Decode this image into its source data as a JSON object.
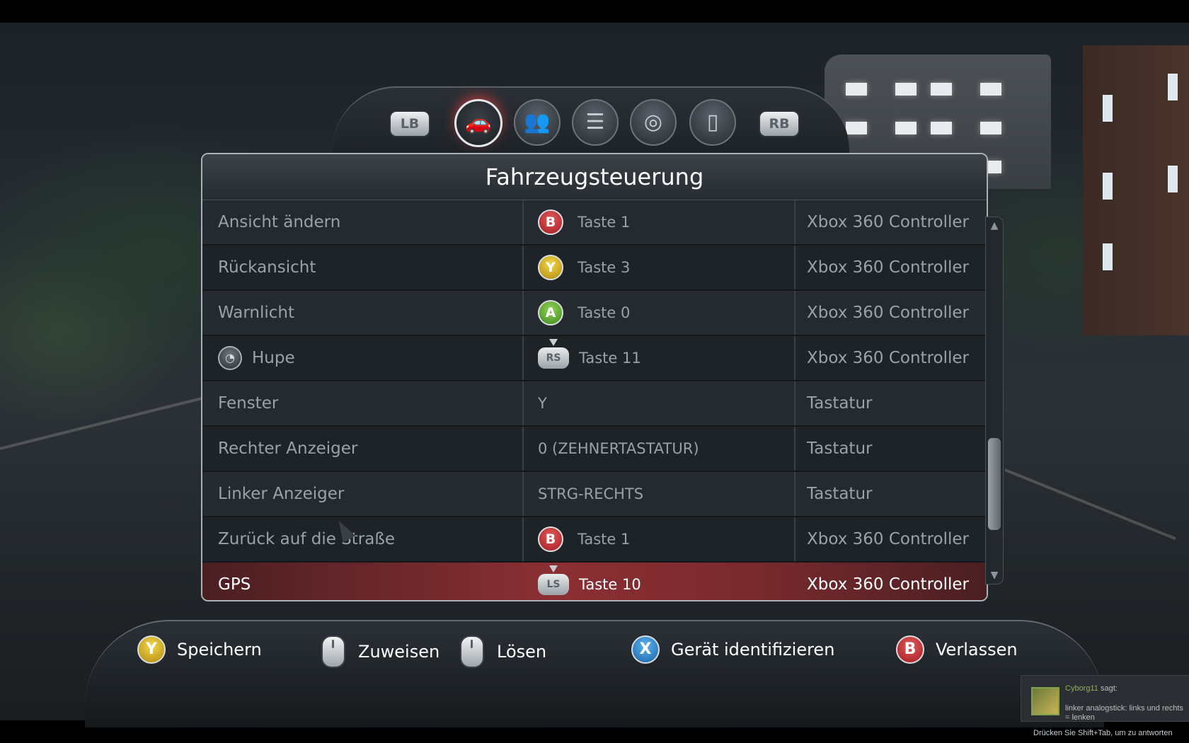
{
  "tabs": {
    "left_bumper": "LB",
    "right_bumper": "RB",
    "icons": [
      "car-icon",
      "people-icon",
      "settings-list-icon",
      "steering-joystick-icon",
      "mouse-icon"
    ],
    "active_index": 0
  },
  "panel": {
    "title": "Fahrzeugsteuerung",
    "rows": [
      {
        "action": "Ansicht ändern",
        "button": "B",
        "binding": "Taste 1",
        "device": "Xbox 360 Controller"
      },
      {
        "action": "Rückansicht",
        "button": "Y",
        "binding": "Taste 3",
        "device": "Xbox 360 Controller"
      },
      {
        "action": "Warnlicht",
        "button": "A",
        "binding": "Taste 0",
        "device": "Xbox 360 Controller"
      },
      {
        "action": "Hupe",
        "button": "RS",
        "binding": "Taste 11",
        "device": "Xbox 360 Controller"
      },
      {
        "action": "Fenster",
        "button": "",
        "binding": "Y",
        "device": "Tastatur"
      },
      {
        "action": "Rechter Anzeiger",
        "button": "",
        "binding": "0 (ZEHNERTASTATUR)",
        "device": "Tastatur"
      },
      {
        "action": "Linker Anzeiger",
        "button": "",
        "binding": "STRG-RECHTS",
        "device": "Tastatur"
      },
      {
        "action": "Zurück auf die Straße",
        "button": "B",
        "binding": "Taste 1",
        "device": "Xbox 360 Controller"
      },
      {
        "action": "GPS",
        "button": "LS",
        "binding": "Taste 10",
        "device": "Xbox 360 Controller"
      }
    ]
  },
  "bottom": {
    "save": {
      "button": "Y",
      "label": "Speichern"
    },
    "assign": {
      "label": "Zuweisen"
    },
    "release": {
      "label": "Lösen"
    },
    "identify": {
      "button": "X",
      "label": "Gerät identifizieren"
    },
    "exit": {
      "button": "B",
      "label": "Verlassen"
    }
  },
  "chat": {
    "sender": "Cyborg11",
    "says": "sagt:",
    "message": "linker analogstick: links und rechts = lenken",
    "hint": "Drücken Sie Shift+Tab, um zu antworten"
  },
  "colors": {
    "selected_row": "#8b2f33",
    "button_b": "#a31c22",
    "button_y": "#b08a0c",
    "button_a": "#3f8a1b",
    "button_x": "#1a64a8"
  }
}
